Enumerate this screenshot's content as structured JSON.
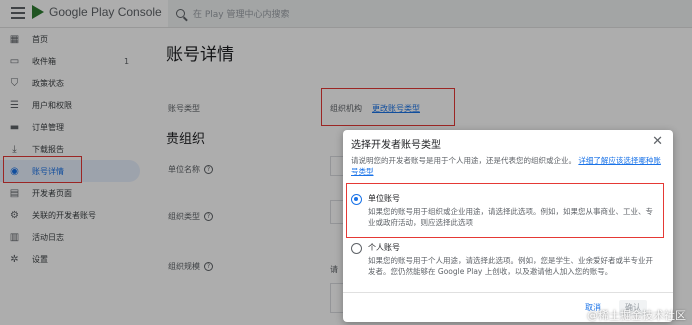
{
  "header": {
    "logo_text": "Google Play Console",
    "search_placeholder": "在 Play 管理中心内搜索"
  },
  "sidebar": {
    "items": [
      {
        "label": "首页",
        "icon": "grid-icon"
      },
      {
        "label": "收件箱",
        "icon": "inbox-icon",
        "count": "1"
      },
      {
        "label": "政策状态",
        "icon": "shield-icon"
      },
      {
        "label": "用户和权限",
        "icon": "people-icon"
      },
      {
        "label": "订单管理",
        "icon": "card-icon"
      },
      {
        "label": "下载报告",
        "icon": "download-icon"
      },
      {
        "label": "账号详情",
        "icon": "account-icon",
        "active": true
      },
      {
        "label": "开发者页面",
        "icon": "page-icon"
      },
      {
        "label": "关联的开发者账号",
        "icon": "link-icon"
      },
      {
        "label": "活动日志",
        "icon": "log-icon"
      },
      {
        "label": "设置",
        "icon": "gear-icon"
      }
    ]
  },
  "main": {
    "title": "账号详情",
    "account_type_label": "账号类型",
    "account_type_value": "组织机构",
    "account_type_link": "更改账号类型",
    "section_title": "贵组织",
    "fields": [
      {
        "label": "单位名称"
      },
      {
        "label": "组织类型"
      },
      {
        "label": "组织规模"
      }
    ],
    "partial_text": "请"
  },
  "dialog": {
    "title": "选择开发者账号类型",
    "description": "请说明您的开发者账号是用于个人用途，还是代表您的组织或企业。",
    "description_link": "详细了解应该选择哪种账号类型",
    "options": [
      {
        "title": "单位账号",
        "description": "如果您的账号用于组织或企业用途，请选择此选项。例如，如果您从事商业、工业、专业或政府活动，则应选择此选项",
        "checked": true
      },
      {
        "title": "个人账号",
        "description": "如果您的账号用于个人用途，请选择此选项。例如，您是学生、业余爱好者或半专业开发者。您仍然能够在 Google Play 上创收，以及邀请他人加入您的账号。",
        "checked": false
      }
    ],
    "cancel_label": "取消",
    "confirm_label": "确认"
  },
  "watermark": "@稀土掘金技术社区",
  "colors": {
    "accent": "#1a73e8",
    "highlight_box": "#e53935",
    "logo_green": "#2e7d32"
  }
}
